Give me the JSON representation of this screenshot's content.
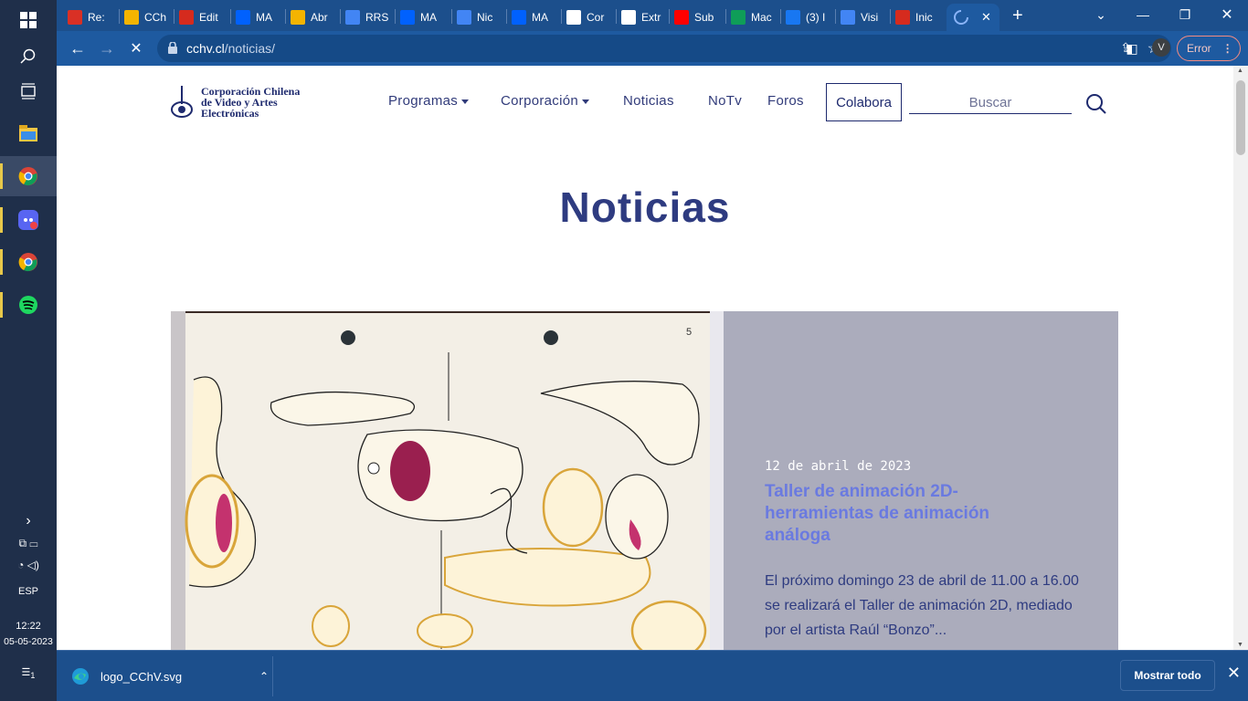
{
  "taskbar": {
    "language": "ESP",
    "time": "12:22",
    "date": "05-05-2023",
    "notification_count": "1"
  },
  "browser": {
    "tabs": [
      {
        "label": "Re:",
        "icon": "gmail-icon",
        "color": "#d93025"
      },
      {
        "label": "CCh",
        "icon": "drive-icon",
        "color": "#f4b400"
      },
      {
        "label": "Edit",
        "icon": "flag-icon",
        "color": "#d52b1e"
      },
      {
        "label": "MA",
        "icon": "dropbox-icon",
        "color": "#0061fe"
      },
      {
        "label": "Abr",
        "icon": "drive-icon",
        "color": "#f4b400"
      },
      {
        "label": "RRS",
        "icon": "docs-icon",
        "color": "#4285f4"
      },
      {
        "label": "MA",
        "icon": "dropbox-icon",
        "color": "#0061fe"
      },
      {
        "label": "Nic",
        "icon": "docs-icon",
        "color": "#4285f4"
      },
      {
        "label": "MA",
        "icon": "dropbox-icon",
        "color": "#0061fe"
      },
      {
        "label": "Cor",
        "icon": "page-icon",
        "color": "#ffffff"
      },
      {
        "label": "Extr",
        "icon": "sheet-icon",
        "color": "#ffffff"
      },
      {
        "label": "Sub",
        "icon": "youtube-icon",
        "color": "#ff0000"
      },
      {
        "label": "Mac",
        "icon": "plus-icon",
        "color": "#0f9d58"
      },
      {
        "label": "(3) I",
        "icon": "facebook-icon",
        "color": "#1877f2"
      },
      {
        "label": "Visi",
        "icon": "docs-icon",
        "color": "#4285f4"
      },
      {
        "label": "Inic",
        "icon": "flag-icon",
        "color": "#d52b1e"
      }
    ],
    "url_host": "cchv.cl",
    "url_path": "/noticias/",
    "profile_initial": "V",
    "error_label": "Error"
  },
  "site": {
    "logo_lines": [
      "Corporación Chilena",
      "de Video y Artes",
      "Electrónicas"
    ],
    "nav": {
      "programas": "Programas",
      "corporacion": "Corporación",
      "noticias": "Noticias",
      "notv": "NoTv",
      "foros": "Foros",
      "colabora": "Colabora"
    },
    "search_placeholder": "Buscar",
    "page_title": "Noticias",
    "news": {
      "date": "12 de abril de 2023",
      "title": "Taller de animación 2D-herramientas de animación análoga",
      "excerpt": "El próximo domingo 23 de abril de 11.00 a 16.00 se realizará el Taller de animación 2D, mediado por el artista Raúl “Bonzo”...",
      "panel_color": "#abacbc",
      "title_color": "#6a7ae0"
    }
  },
  "downloads": {
    "filename": "logo_CChV.svg",
    "show_all": "Mostrar todo"
  }
}
